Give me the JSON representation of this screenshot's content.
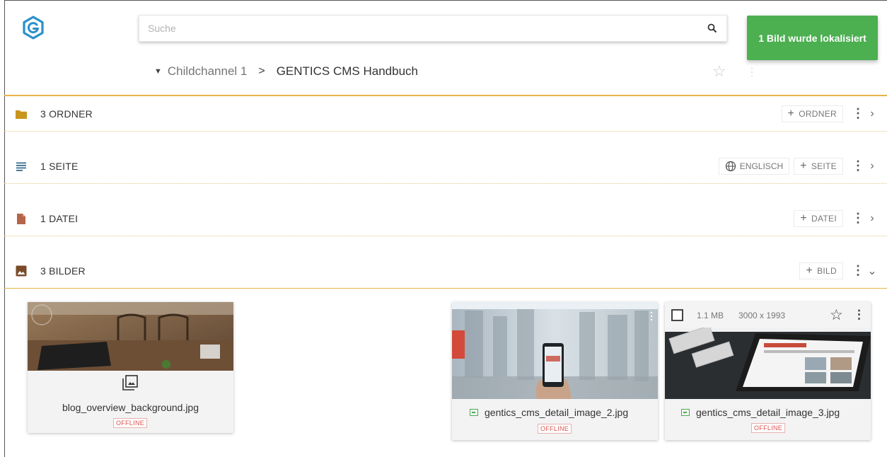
{
  "search": {
    "placeholder": "Suche"
  },
  "toast": {
    "text": "1 Bild wurde lokalisiert",
    "color": "#4caf50"
  },
  "breadcrumb": {
    "channel": "Childchannel 1",
    "separator": ">",
    "current": "GENTICS CMS Handbuch"
  },
  "accent_color": "#e8b34a",
  "sections": [
    {
      "label": "3 ORDNER",
      "icon": "folder-icon",
      "icon_color": "#c8961e",
      "add_label": "ORDNER",
      "expanded": false
    },
    {
      "label": "1 SEITE",
      "icon": "page-lines-icon",
      "icon_color": "#3b6e8f",
      "lang_label": "ENGLISCH",
      "add_label": "SEITE",
      "expanded": false
    },
    {
      "label": "1 DATEI",
      "icon": "file-icon",
      "icon_color": "#b5654a",
      "add_label": "DATEI",
      "expanded": false
    },
    {
      "label": "3 BILDER",
      "icon": "image-icon",
      "icon_color": "#7a4a2a",
      "add_label": "BILD",
      "expanded": true
    }
  ],
  "images": [
    {
      "name": "blog_overview_background.jpg",
      "status": "OFFLINE"
    },
    {
      "name": "gentics_cms_detail_image_2.jpg",
      "status": "OFFLINE"
    },
    {
      "name": "gentics_cms_detail_image_3.jpg",
      "status": "OFFLINE",
      "size": "1.1 MB",
      "dimensions": "3000 x 1993"
    }
  ]
}
